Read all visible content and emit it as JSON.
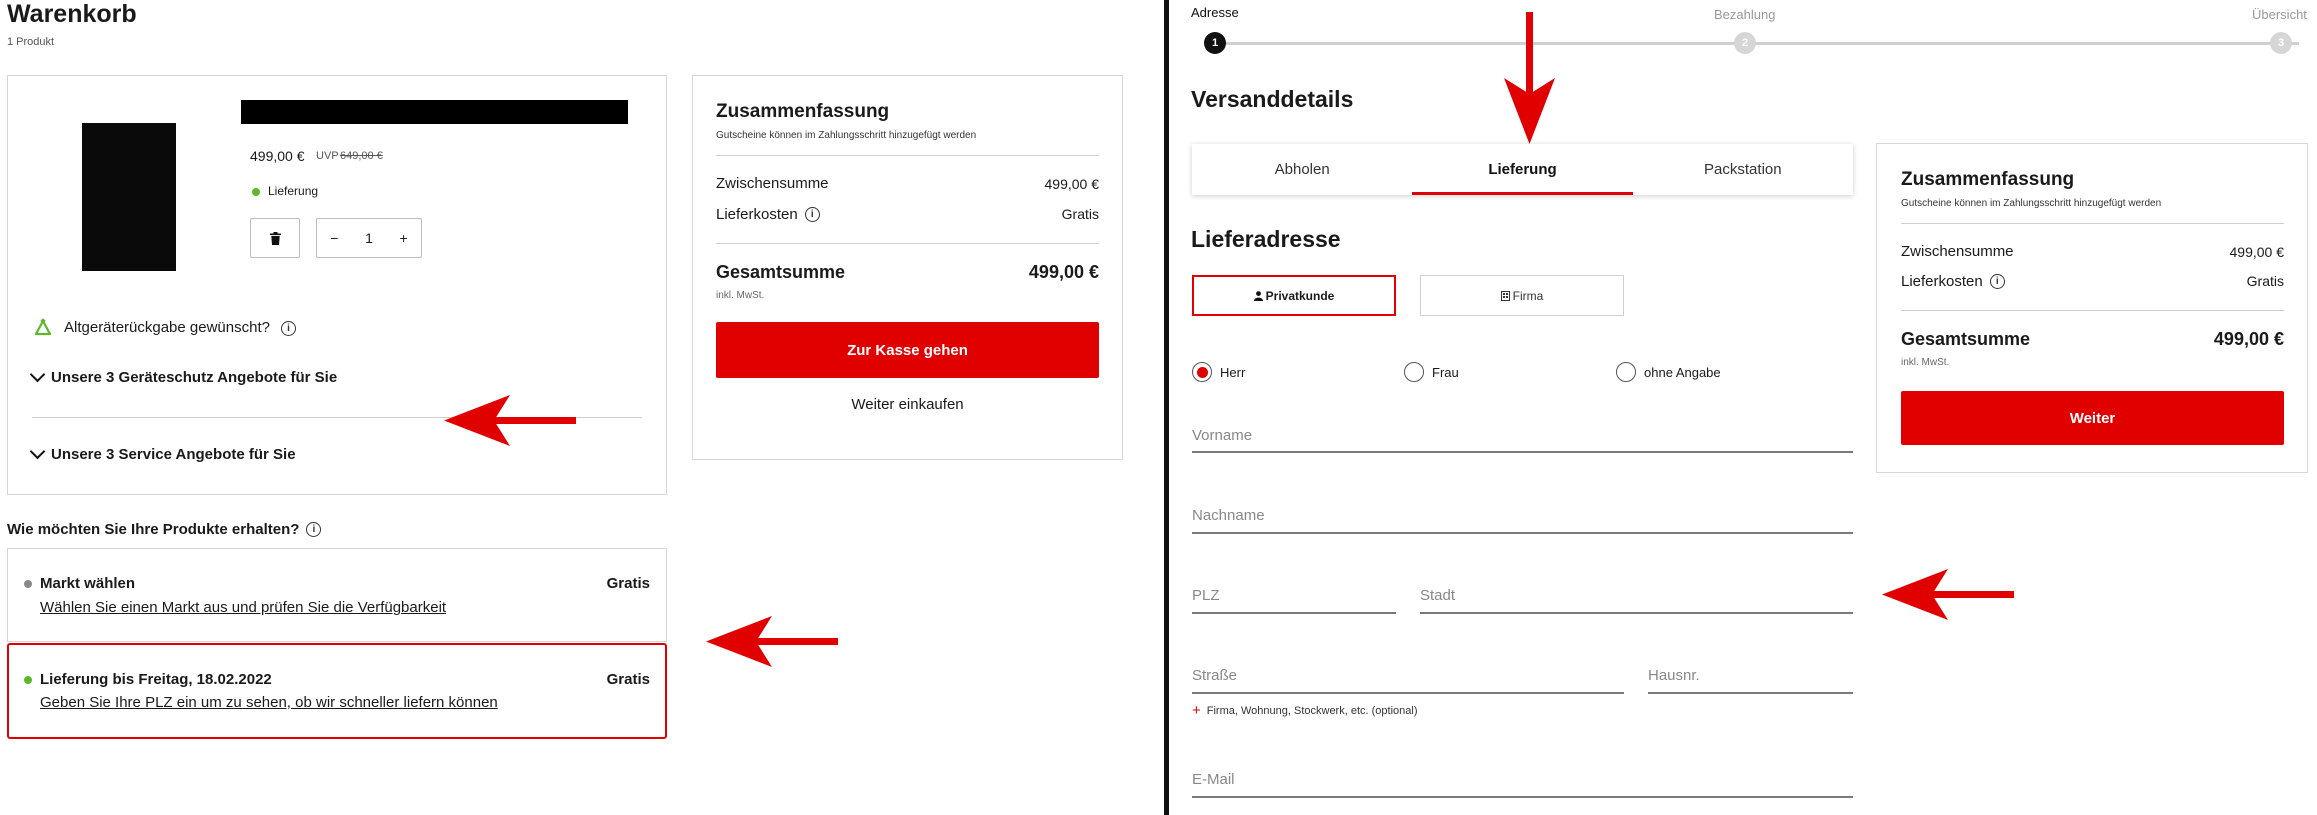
{
  "cart": {
    "title": "Warenkorb",
    "count": "1 Produkt",
    "product": {
      "price": "499,00 €",
      "uvp_label": "UVP",
      "uvp_value": "649,00 €",
      "delivery_label": "Lieferung",
      "quantity": "1",
      "minus": "−",
      "plus": "+"
    },
    "recycle_label": "Altgeräterückgabe gewünscht?",
    "accordion_1": "Unsere 3 Geräteschutz Angebote für Sie",
    "accordion_2": "Unsere 3 Service Angebote für Sie"
  },
  "summary_left": {
    "title": "Zusammenfassung",
    "subtitle": "Gutscheine können im Zahlungsschritt hinzugefügt werden",
    "subtotal_label": "Zwischensumme",
    "subtotal_value": "499,00 €",
    "shipping_label": "Lieferkosten",
    "shipping_value": "Gratis",
    "total_label": "Gesamtsumme",
    "total_value": "499,00 €",
    "vat_note": "inkl. MwSt.",
    "checkout_button": "Zur Kasse gehen",
    "continue_link": "Weiter einkaufen"
  },
  "shipping": {
    "question": "Wie möchten Sie Ihre Produkte erhalten?",
    "option_1": {
      "title": "Markt wählen",
      "link": "Wählen Sie einen Markt aus und prüfen Sie die Verfügbarkeit",
      "price": "Gratis",
      "dot_color": "#8a8a8a"
    },
    "option_2": {
      "title": "Lieferung bis Freitag, 18.02.2022",
      "link": "Geben Sie Ihre PLZ ein um zu sehen, ob wir schneller liefern können",
      "price": "Gratis",
      "dot_color": "#5cb82a"
    }
  },
  "stepper": {
    "steps": [
      {
        "label": "Adresse",
        "number": "1"
      },
      {
        "label": "Bezahlung",
        "number": "2"
      },
      {
        "label": "Übersicht",
        "number": "3"
      }
    ]
  },
  "shipping_details": {
    "title": "Versanddetails",
    "tabs": [
      "Abholen",
      "Lieferung",
      "Packstation"
    ],
    "active_tab": "Lieferung",
    "address_title": "Lieferadresse",
    "customer_private": "Privatkunde",
    "customer_company": "Firma",
    "salutations": [
      "Herr",
      "Frau",
      "ohne Angabe"
    ],
    "selected_salutation": "Herr",
    "fields": {
      "first_name": "Vorname",
      "last_name": "Nachname",
      "zip": "PLZ",
      "city": "Stadt",
      "street": "Straße",
      "house_no": "Hausnr.",
      "address_extra": "Firma, Wohnung, Stockwerk, etc. (optional)",
      "email": "E-Mail"
    }
  },
  "summary_right": {
    "title": "Zusammenfassung",
    "subtitle": "Gutscheine können im Zahlungsschritt hinzugefügt werden",
    "subtotal_label": "Zwischensumme",
    "subtotal_value": "499,00 €",
    "shipping_label": "Lieferkosten",
    "shipping_value": "Gratis",
    "total_label": "Gesamtsumme",
    "total_value": "499,00 €",
    "vat_note": "inkl. MwSt.",
    "next_button": "Weiter"
  },
  "colors": {
    "accent_red": "#e10000",
    "available_green": "#5cb82a",
    "annotation_arrow": "#e10000"
  }
}
